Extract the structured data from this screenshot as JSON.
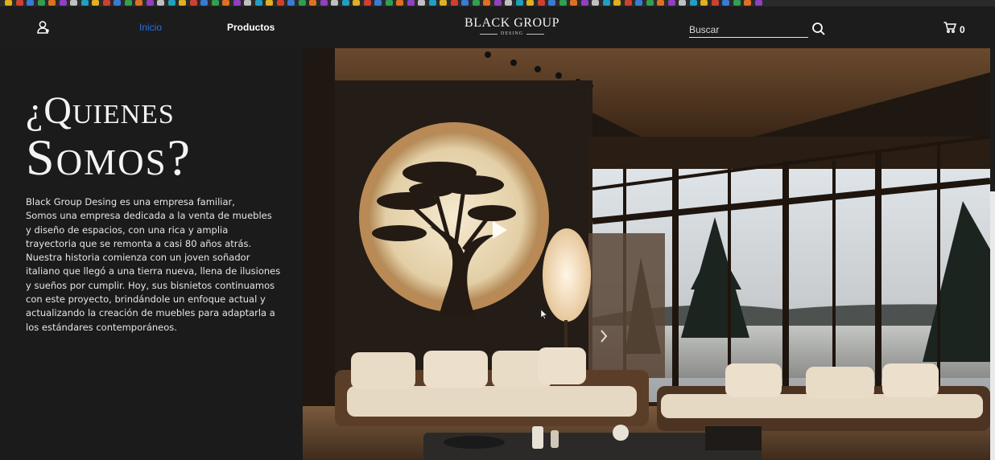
{
  "header": {
    "nav": {
      "home": "Inicio",
      "products": "Productos"
    },
    "brand": {
      "title": "BLACK GROUP",
      "subtitle": "DESING"
    },
    "search": {
      "placeholder": "Buscar",
      "value": ""
    },
    "cart": {
      "count": "0"
    },
    "icons": {
      "user": "user-icon",
      "search": "search-icon",
      "cart": "cart-icon"
    }
  },
  "about": {
    "title_line1": "¿Quienes",
    "title_line2": "Somos?",
    "body_lines": [
      "Black Group Desing es una empresa familiar,",
      "Somos una empresa dedicada a la venta de muebles",
      "y diseño de espacios, con una rica y amplia",
      "trayectoria que se remonta a casi 80 años atrás.",
      "Nuestra historia comienza con un joven soñador",
      "italiano que llegó a una tierra nueva, llena de ilusiones",
      "y sueños por cumplir. Hoy, sus bisnietos continuamos",
      "con este proyecto, brindándole un enfoque actual y",
      "actualizando la creación de muebles para adaptarla a",
      "los estándares contemporáneos."
    ]
  },
  "hero": {
    "image": "living-room-with-bonsai-moon-artwork",
    "controls": {
      "play": "play-icon",
      "next": "chevron-right-icon"
    }
  },
  "colors": {
    "background": "#1b1b1b",
    "header": "#1c1c1c",
    "nav_active": "#2f6fe0",
    "text": "#ffffff"
  }
}
